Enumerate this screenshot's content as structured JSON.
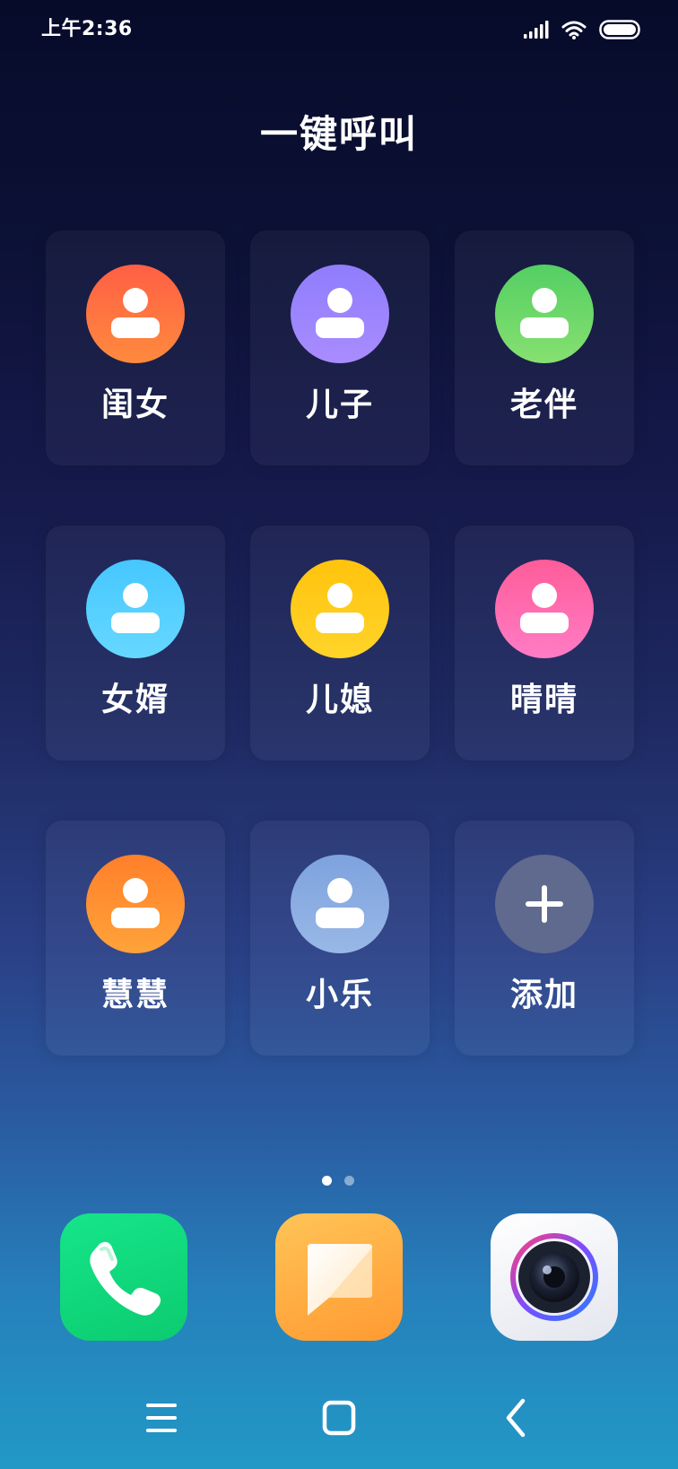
{
  "status_bar": {
    "time": "上午2:36",
    "icons": [
      "cellular-signal-icon",
      "wifi-icon",
      "battery-icon"
    ]
  },
  "page": {
    "title": "一键呼叫"
  },
  "contacts": [
    {
      "label": "闺女",
      "icon": "person-icon",
      "color_start": "#ff5f45",
      "color_end": "#ff8a3d"
    },
    {
      "label": "儿子",
      "icon": "person-icon",
      "color_start": "#8f7dfc",
      "color_end": "#a98cff"
    },
    {
      "label": "老伴",
      "icon": "person-icon",
      "color_start": "#54cf63",
      "color_end": "#86e070"
    },
    {
      "label": "女婿",
      "icon": "person-icon",
      "color_start": "#45c7ff",
      "color_end": "#66d8ff"
    },
    {
      "label": "儿媳",
      "icon": "person-icon",
      "color_start": "#ffc30d",
      "color_end": "#ffd42a"
    },
    {
      "label": "晴晴",
      "icon": "person-icon",
      "color_start": "#ff5c99",
      "color_end": "#ff7cc5"
    },
    {
      "label": "慧慧",
      "icon": "person-icon",
      "color_start": "#ff7f2a",
      "color_end": "#ffa33a"
    },
    {
      "label": "小乐",
      "icon": "person-icon",
      "color_start": "#7ea2de",
      "color_end": "#98b8e6"
    }
  ],
  "add_contact": {
    "label": "添加",
    "icon": "plus-icon",
    "color": "#5f6a8e"
  },
  "pager": {
    "page_count": 2,
    "current_page": 1
  },
  "dock": [
    {
      "app": "phone",
      "icon": "phone-icon"
    },
    {
      "app": "messages",
      "icon": "message-icon"
    },
    {
      "app": "camera",
      "icon": "camera-icon"
    }
  ],
  "navigation": {
    "icons": [
      "menu-icon",
      "home-icon",
      "back-icon"
    ]
  }
}
